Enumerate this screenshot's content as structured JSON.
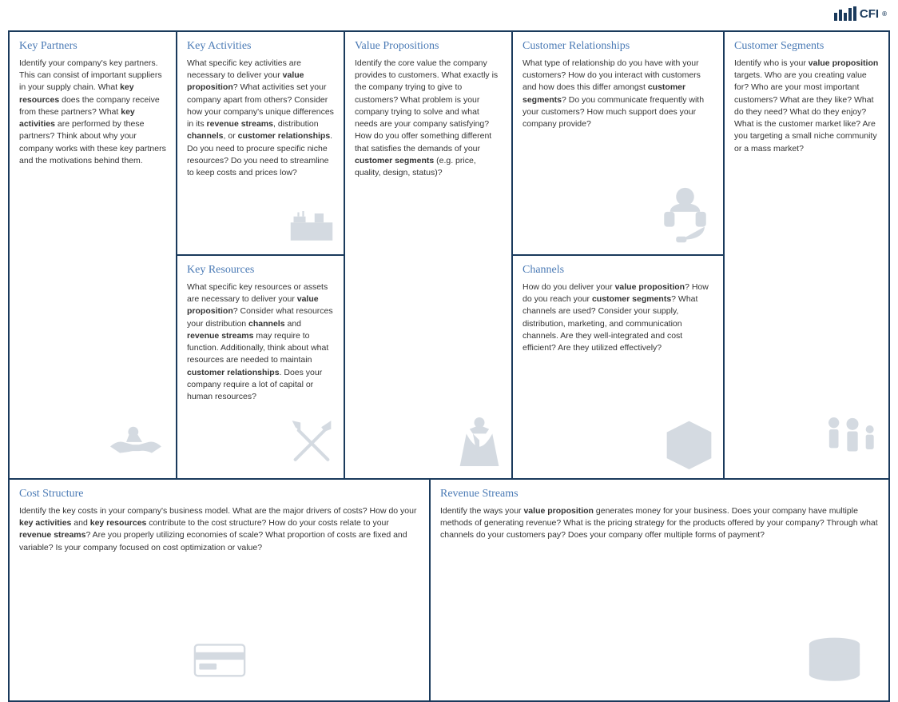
{
  "logo": {
    "text": "CFI",
    "bars": [
      14,
      10,
      16,
      12,
      18
    ]
  },
  "cells": {
    "key_partners": {
      "title": "Key Partners",
      "text": "Identify your company's key partners. This can consist of important suppliers in your supply chain. What <b>key resources</b> does the company receive from these partners? What <b>key activities</b> are performed by these partners? Think about why your company works with these key partners and the motivations behind them."
    },
    "key_activities": {
      "title": "Key Activities",
      "text": "What specific key activities are necessary to deliver your <b>value proposition</b>? What activities set your company apart from others? Consider how your company's unique differences in its <b>revenue streams</b>, distribution <b>channels</b>, or <b>customer relationships</b>. Do you need to procure specific niche resources? Do you need to streamline to keep costs and prices low?"
    },
    "key_resources": {
      "title": "Key Resources",
      "text": "What specific key resources or assets are necessary to deliver your <b>value proposition</b>? Consider what resources your distribution <b>channels</b> and <b>revenue streams</b> may require to function. Additionally, think about what resources are needed to maintain <b>customer relationships</b>. Does your company require a lot of capital or human resources?"
    },
    "value_propositions": {
      "title": "Value Propositions",
      "text": "Identify the core value the company provides to customers. What exactly is the company trying to give to customers? What problem is your company trying to solve and what needs are your company satisfying? How do you offer something different that satisfies the demands of your <b>customer segments</b> (e.g. price, quality, design, status)?"
    },
    "customer_relationships": {
      "title": "Customer Relationships",
      "text": "What type of relationship do you have with your customers? How do you interact with customers and how does this differ amongst <b>customer segments</b>? Do you communicate frequently with your customers? How much support does your company provide?"
    },
    "channels": {
      "title": "Channels",
      "text": "How do you deliver your <b>value proposition</b>? How do you reach your <b>customer segments</b>? What channels are used? Consider your supply, distribution, marketing, and communication channels. Are they well-integrated and cost efficient? Are they utilized effectively?"
    },
    "customer_segments": {
      "title": "Customer Segments",
      "text": "Identify who is your <b>value proposition</b> targets. Who are you creating value for? Who are your most important customers? What are they like? What do they need? What do they enjoy? What is the customer market like? Are you targeting a small niche community or a mass market?"
    },
    "cost_structure": {
      "title": "Cost Structure",
      "text": "Identify the key costs in your company's business model. What are the major drivers of costs? How do your <b>key activities</b> and <b>key resources</b> contribute to the cost structure? How do your costs relate to your <b>revenue streams</b>? Are you properly utilizing economies of scale? What proportion of costs are fixed and variable? Is your company focused on cost optimization or value?"
    },
    "revenue_streams": {
      "title": "Revenue Streams",
      "text": "Identify the ways your <b>value proposition</b> generates money for your business. Does your company have multiple methods of generating revenue? What is the pricing strategy for the products offered by your company? Through what channels do your customers pay? Does your company offer multiple forms of payment?"
    }
  }
}
